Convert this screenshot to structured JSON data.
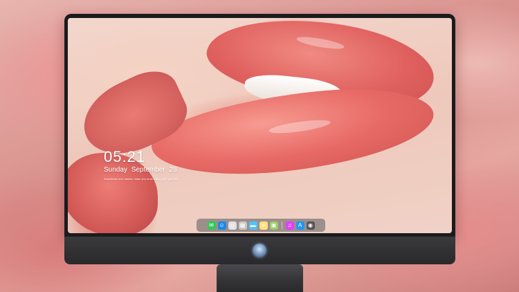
{
  "lockscreen": {
    "time": "05:21",
    "weekday": "Sunday",
    "month": "September",
    "day": "28",
    "quote": "Sometimes love stands, make you most happy, give you the"
  },
  "dock": {
    "items": [
      {
        "name": "messages-icon",
        "glyph": "✉",
        "color": "#34c759"
      },
      {
        "name": "finder-icon",
        "glyph": "☺",
        "color": "#1e88e5"
      },
      {
        "name": "safari-icon",
        "glyph": "◎",
        "color": "#e0e0e0"
      },
      {
        "name": "preview-icon",
        "glyph": "▦",
        "color": "#c8c8c8"
      },
      {
        "name": "folder-icon",
        "glyph": "▬",
        "color": "#4fc3f7"
      },
      {
        "name": "notes-icon",
        "glyph": "≡",
        "color": "#ffe082"
      },
      {
        "name": "photos-icon",
        "glyph": "▣",
        "color": "#9ccc65"
      }
    ],
    "items_right": [
      {
        "name": "itunes-icon",
        "glyph": "♫",
        "color": "#e040fb"
      },
      {
        "name": "app-store-icon",
        "glyph": "A",
        "color": "#2196f3"
      },
      {
        "name": "camera-icon",
        "glyph": "◉",
        "color": "#555555"
      }
    ]
  },
  "colors": {
    "dock_bg": "#5a5a5f",
    "bezel": "#1b1b1d",
    "chin": "#333336"
  }
}
